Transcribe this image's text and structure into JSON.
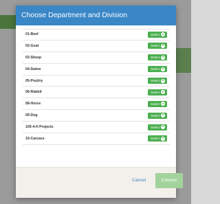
{
  "modal": {
    "title": "Choose Department and Division",
    "select_label": "Select",
    "rows": [
      {
        "label": "01-Beef"
      },
      {
        "label": "02-Goat"
      },
      {
        "label": "03-Sheep"
      },
      {
        "label": "04-Swine"
      },
      {
        "label": "05-Poultry"
      },
      {
        "label": "06-Rabbit"
      },
      {
        "label": "08-Horse"
      },
      {
        "label": "09-Dog"
      },
      {
        "label": "100-4-H Projects"
      },
      {
        "label": "10-Carcass"
      }
    ],
    "cancel_label": "Cancel",
    "choose_label": "Choose"
  },
  "colors": {
    "header": "#3a87c7",
    "select_button": "#4caf50",
    "choose_button": "#a3d39c"
  }
}
